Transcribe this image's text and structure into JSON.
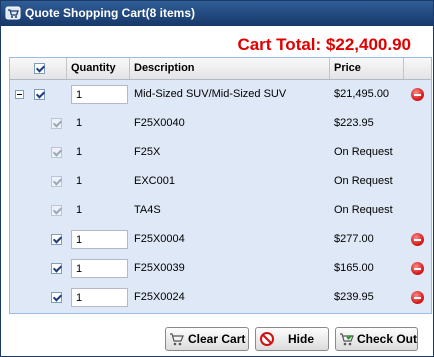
{
  "window": {
    "title": "Quote Shopping Cart(8 items)"
  },
  "cart_total": "Cart Total: $22,400.90",
  "grid": {
    "columns": [
      "Quantity",
      "Description",
      "Price"
    ],
    "rows": [
      {
        "qty": "1",
        "description": "Mid-Sized SUV/Mid-Sized SUV",
        "price": "$21,495.00"
      },
      {
        "qty": "1",
        "description": "F25X0040",
        "price": "$223.95"
      },
      {
        "qty": "1",
        "description": "F25X",
        "price": "On Request"
      },
      {
        "qty": "1",
        "description": "EXC001",
        "price": "On Request"
      },
      {
        "qty": "1",
        "description": "TA4S",
        "price": "On Request"
      },
      {
        "qty": "1",
        "description": "F25X0004",
        "price": "$277.00"
      },
      {
        "qty": "1",
        "description": "F25X0039",
        "price": "$165.00"
      },
      {
        "qty": "1",
        "description": "F25X0024",
        "price": "$239.95"
      }
    ]
  },
  "buttons": {
    "clear": "Clear Cart",
    "hide": "Hide",
    "checkout": "Check Out"
  },
  "icons": {
    "title": "cart-icon",
    "remove": "remove-icon",
    "clear": "clear-cart-icon",
    "hide": "no-entry-icon",
    "checkout": "cart-check-icon"
  },
  "colors": {
    "title_bar": "#23477d",
    "total": "#e00000",
    "grid_bg": "#dfe8f6",
    "remove": "#d01010"
  }
}
